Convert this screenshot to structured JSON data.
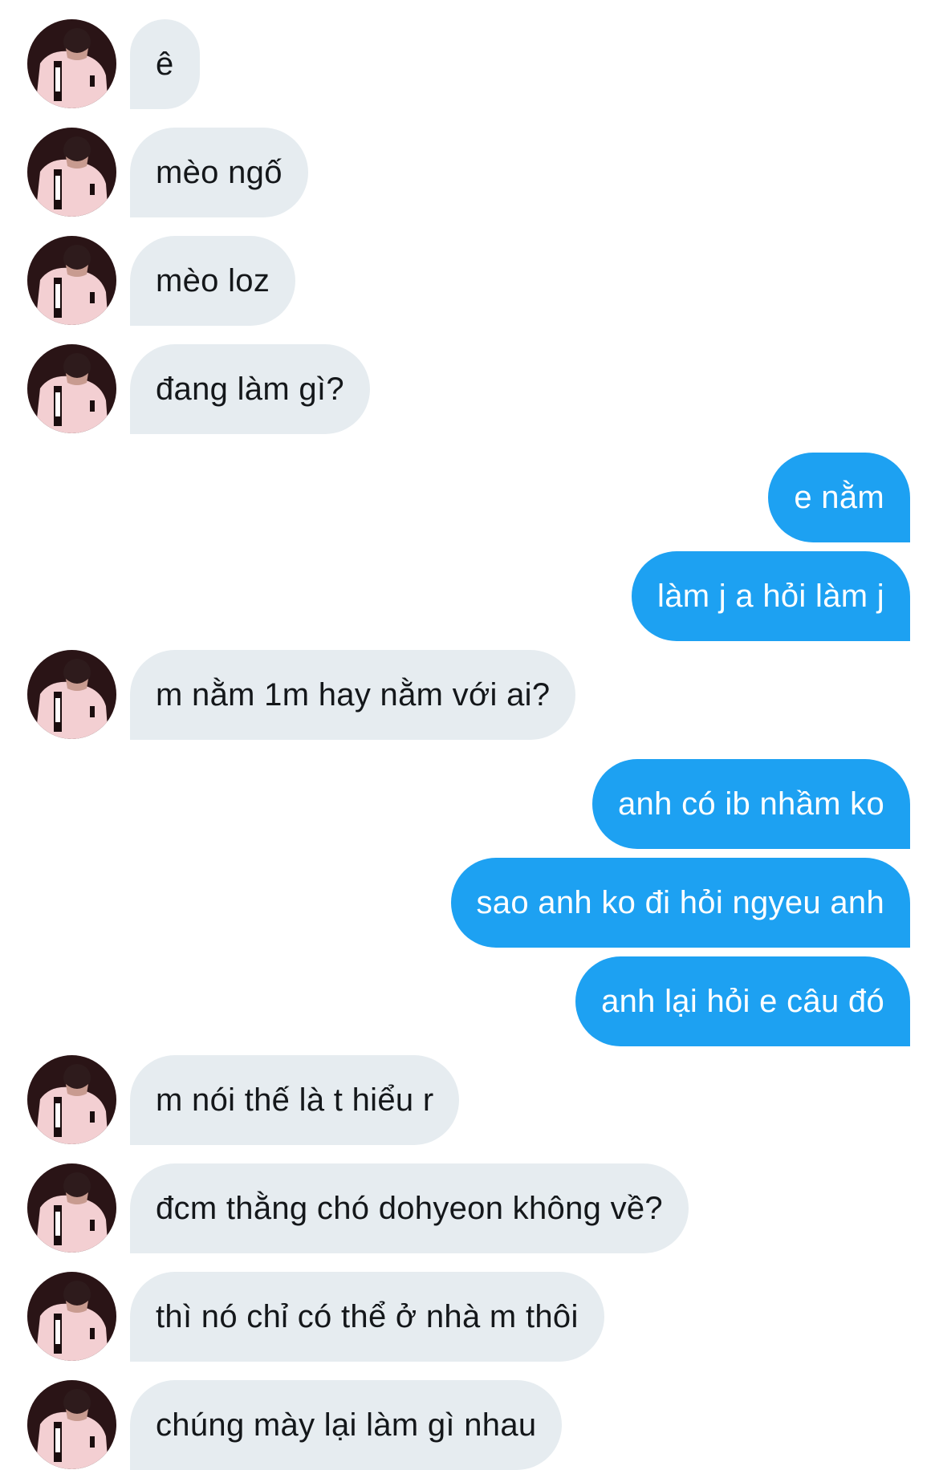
{
  "colors": {
    "incoming_bubble": "#e6ecf0",
    "outgoing_bubble": "#1da1f2",
    "incoming_text": "#14171a",
    "outgoing_text": "#ffffff"
  },
  "contact": {
    "avatar_icon": "profile-photo-pink-jacket"
  },
  "messages": [
    {
      "from": "them",
      "text": "ê"
    },
    {
      "from": "them",
      "text": "mèo ngố"
    },
    {
      "from": "them",
      "text": "mèo loz"
    },
    {
      "from": "them",
      "text": "đang làm gì?"
    },
    {
      "from": "me",
      "text": "e nằm"
    },
    {
      "from": "me",
      "text": "làm j a hỏi làm j"
    },
    {
      "from": "them",
      "text": "m nằm 1m hay nằm với ai?"
    },
    {
      "from": "me",
      "text": "anh có ib nhầm ko"
    },
    {
      "from": "me",
      "text": "sao anh ko đi hỏi ngyeu anh"
    },
    {
      "from": "me",
      "text": "anh lại hỏi e câu đó"
    },
    {
      "from": "them",
      "text": "m nói thế là t hiểu r"
    },
    {
      "from": "them",
      "text": "đcm thằng chó dohyeon không về?"
    },
    {
      "from": "them",
      "text": "thì nó chỉ có thể ở nhà m thôi"
    },
    {
      "from": "them",
      "text": "chúng mày lại làm gì nhau"
    }
  ]
}
